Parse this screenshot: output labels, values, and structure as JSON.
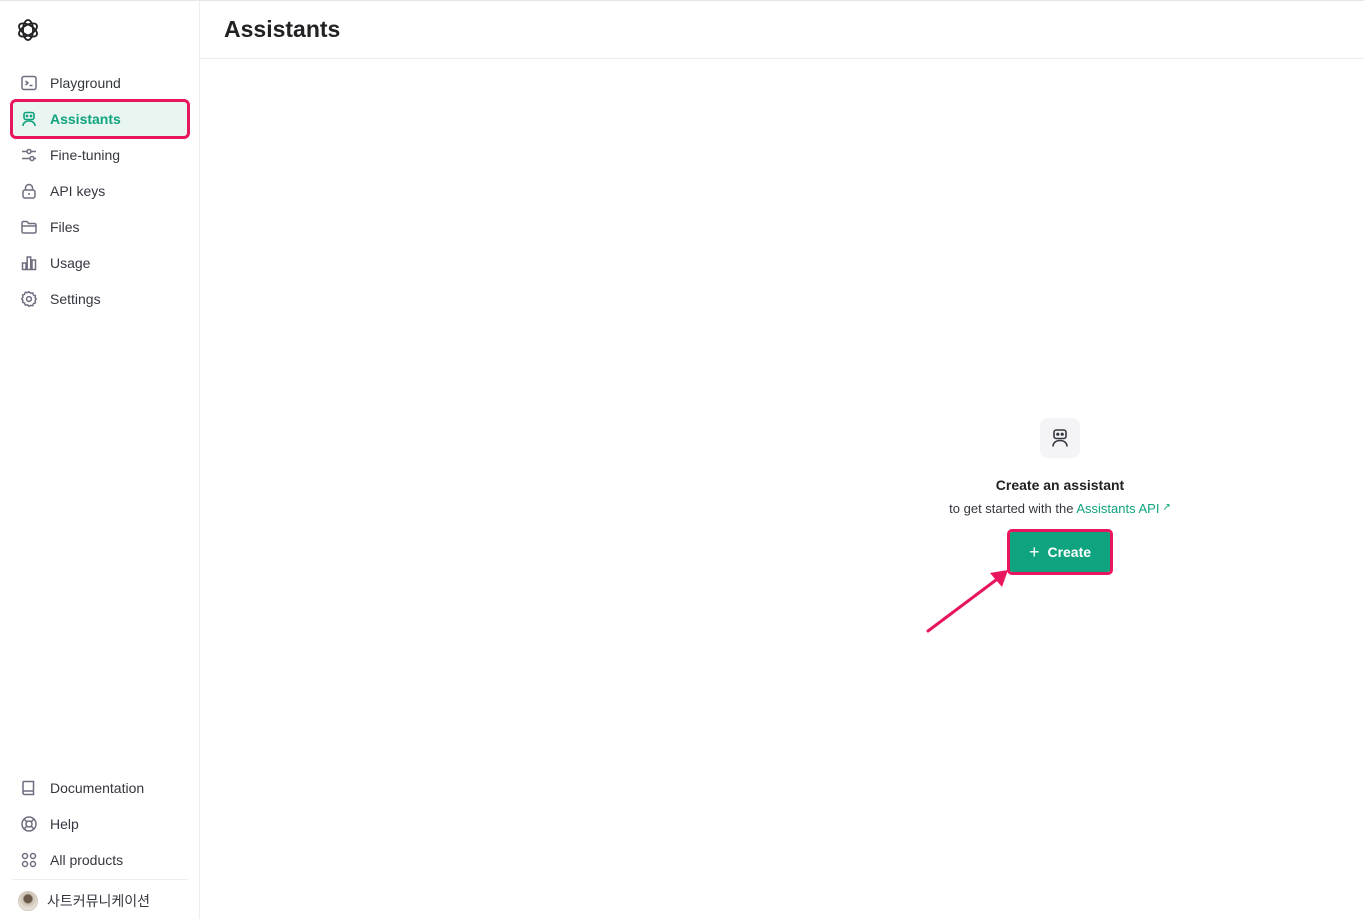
{
  "sidebar": {
    "nav_items": [
      {
        "label": "Playground",
        "icon": "terminal-icon"
      },
      {
        "label": "Assistants",
        "icon": "robot-icon",
        "active": true
      },
      {
        "label": "Fine-tuning",
        "icon": "sliders-icon"
      },
      {
        "label": "API keys",
        "icon": "lock-icon"
      },
      {
        "label": "Files",
        "icon": "folder-icon"
      },
      {
        "label": "Usage",
        "icon": "bar-chart-icon"
      },
      {
        "label": "Settings",
        "icon": "gear-icon"
      }
    ],
    "bottom_items": [
      {
        "label": "Documentation",
        "icon": "book-icon"
      },
      {
        "label": "Help",
        "icon": "lifebuoy-icon"
      },
      {
        "label": "All products",
        "icon": "grid-icon"
      }
    ],
    "account_name": "사트커뮤니케이션"
  },
  "header": {
    "title": "Assistants"
  },
  "empty_state": {
    "title": "Create an assistant",
    "subtitle_prefix": "to get started with the ",
    "link_text": "Assistants API",
    "link_ext": "↗",
    "create_button": "Create",
    "create_plus": "+"
  },
  "colors": {
    "accent": "#10a37f",
    "highlight": "#e8155f",
    "active_bg": "#e8f5f0"
  }
}
